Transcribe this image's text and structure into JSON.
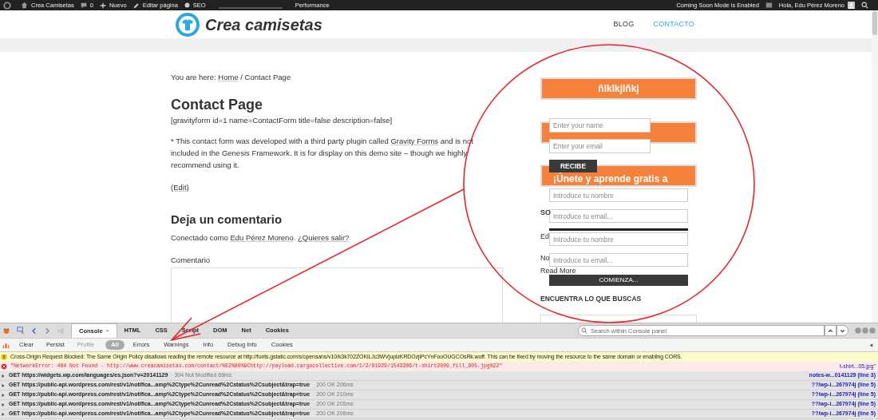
{
  "admin_bar": {
    "site": "Crea Camisetas",
    "comments": "0",
    "new": "Nuevo",
    "edit": "Editar página",
    "seo": "SEO",
    "performance": "Performance",
    "notice": "Coming Soon Mode is Enabled",
    "greeting": "Hola, Edu Pérez Moreno"
  },
  "header": {
    "logo_text": "Crea camisetas",
    "nav": [
      {
        "label": "BLOG",
        "selected": false
      },
      {
        "label": "CONTACTO",
        "selected": true
      }
    ]
  },
  "breadcrumb": {
    "prefix": "You are here: ",
    "link": "Home",
    "current": " / Contact Page"
  },
  "page": {
    "title": "Contact Page",
    "shortcode": "[gravityform id=1 name=ContactForm title=false description=false]",
    "note_before": "* This contact form was developed with a third party plugin called ",
    "note_link": "Gravity Forms",
    "note_after": " and is not included in the Genesis Framework. It is for display on this demo site – though we highly recommend using it.",
    "edit": "(Edit)"
  },
  "comments": {
    "title": "Deja un comentario",
    "logged_prefix": "Conectado como ",
    "user": "Edu Pérez Moreno",
    "separator": ". ",
    "logout": "¿Quieres salir?",
    "label": "Comentario"
  },
  "sidebar": {
    "banner_1": "ñlkIkjlñkj",
    "banner_3": "¡Únete y aprende gratis a",
    "name_field": {
      "placeholder": "Enter your name"
    },
    "email_field": {
      "placeholder": "Enter your email"
    },
    "receive_button": "RECIBE",
    "fields": [
      {
        "placeholder": "Introduce tu nombre"
      },
      {
        "placeholder": "Introduce tu email..."
      },
      {
        "placeholder": "Introduce tu nombre"
      },
      {
        "placeholder": "Introduce tu email..."
      }
    ],
    "side_texts": [
      "SO",
      "Ed",
      "No"
    ],
    "read_more": "Read More",
    "start_button": "COMIENZA...",
    "search_title": "ENCUENTRA LO QUE BUSCAS"
  },
  "devtools": {
    "tabs": [
      {
        "label": "Console",
        "selected": true
      },
      {
        "label": "HTML",
        "selected": false
      },
      {
        "label": "CSS",
        "selected": false
      },
      {
        "label": "Script",
        "selected": false
      },
      {
        "label": "DOM",
        "selected": false
      },
      {
        "label": "Net",
        "selected": false
      },
      {
        "label": "Cookies",
        "selected": false
      }
    ],
    "search": {
      "placeholder": "Search within Console panel"
    },
    "actions": [
      {
        "label": "Clear",
        "disabled": false
      },
      {
        "label": "Persist",
        "disabled": false
      },
      {
        "label": "Profile",
        "disabled": true
      }
    ],
    "filters": [
      {
        "label": "All",
        "selected": true
      },
      {
        "label": "Errors",
        "selected": false
      },
      {
        "label": "Warnings",
        "selected": false
      },
      {
        "label": "Info",
        "selected": false
      },
      {
        "label": "Debug Info",
        "selected": false
      },
      {
        "label": "Cookies",
        "selected": false
      }
    ],
    "log": [
      {
        "kind": "warning",
        "message": "Cross-Origin Request Blocked: The Same Origin Policy disallows reading the remote resource at http://fonts.gstatic.com/s/opensans/v10/k3k702ZOKiLJc3WVjuplzKRDOzjiPcYnFooOUGCOsRk.woff. This can be fixed by moving the resource to the same domain or enabling CORS."
      },
      {
        "kind": "error",
        "message": "\"NetworkError: 404 Not Found - http://www.creacamisetas.com/contact/%E2%80%9Chttp://payload.cargocollective.com/1/2/91929/1543306/t-shirt2009_fill_905.jpg%22\"",
        "source": "t-shirt...05.jpg\""
      },
      {
        "kind": "request",
        "message": "GET https://widgets.wp.com/languages/es.json?v=20141129",
        "status": "304 Not Modified 68ms",
        "source": "notes-w...0141129 (line 3)"
      },
      {
        "kind": "request",
        "message": "GET https://public-api.wordpress.com/rest/v1/notifica...amp%2Ctype%2Cunread%2Cstatus%2Csubject&trap=true",
        "status": "200 OK 206ms",
        "source": "??/wp-i...267974j (line 5)"
      },
      {
        "kind": "request",
        "message": "GET https://public-api.wordpress.com/rest/v1/notifica...amp%2Ctype%2Cunread%2Cstatus%2Csubject&trap=true",
        "status": "200 OK 210ms",
        "source": "??/wp-i...267974j (line 5)"
      },
      {
        "kind": "request",
        "message": "GET https://public-api.wordpress.com/rest/v1/notifica...amp%2Ctype%2Cunread%2Cstatus%2Csubject&trap=true",
        "status": "200 OK 205ms",
        "source": "??/wp-i...267974j (line 5)"
      },
      {
        "kind": "request",
        "message": "GET https://public-api.wordpress.com/rest/v1/notifica...amp%2Ctype%2Cunread%2Cstatus%2Csubject&trap=true",
        "status": "200 OK 209ms",
        "source": "??/wp-i...267974j (line 5)"
      }
    ]
  }
}
